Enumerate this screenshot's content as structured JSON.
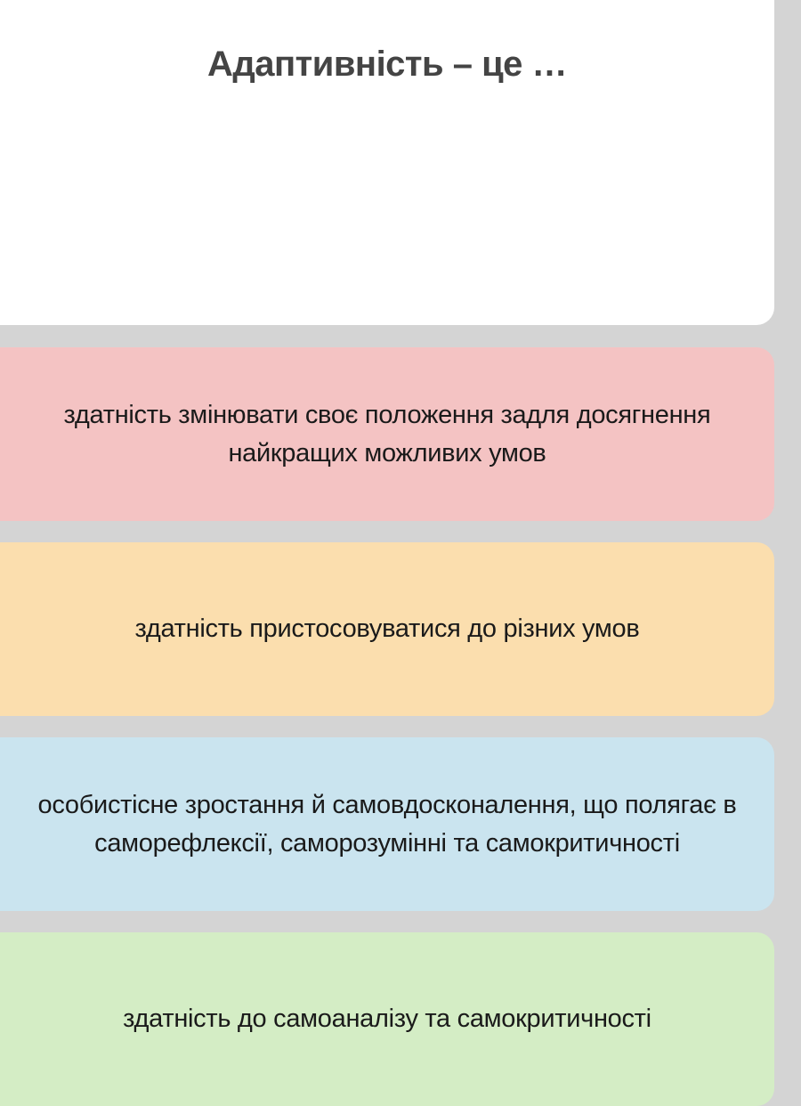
{
  "question": {
    "title": "Адаптивність – це …"
  },
  "options": [
    {
      "text": "здатність змінювати своє положення задля досягнення найкращих можливих умов",
      "color": "red"
    },
    {
      "text": "здатність пристосовуватися до різних умов",
      "color": "orange"
    },
    {
      "text": "особистісне зростання й самовдосконалення, що полягає в саморефлексії, саморозумінні та самокритичності",
      "color": "blue"
    },
    {
      "text": "здатність до самоаналізу та самокритичності",
      "color": "green"
    }
  ]
}
